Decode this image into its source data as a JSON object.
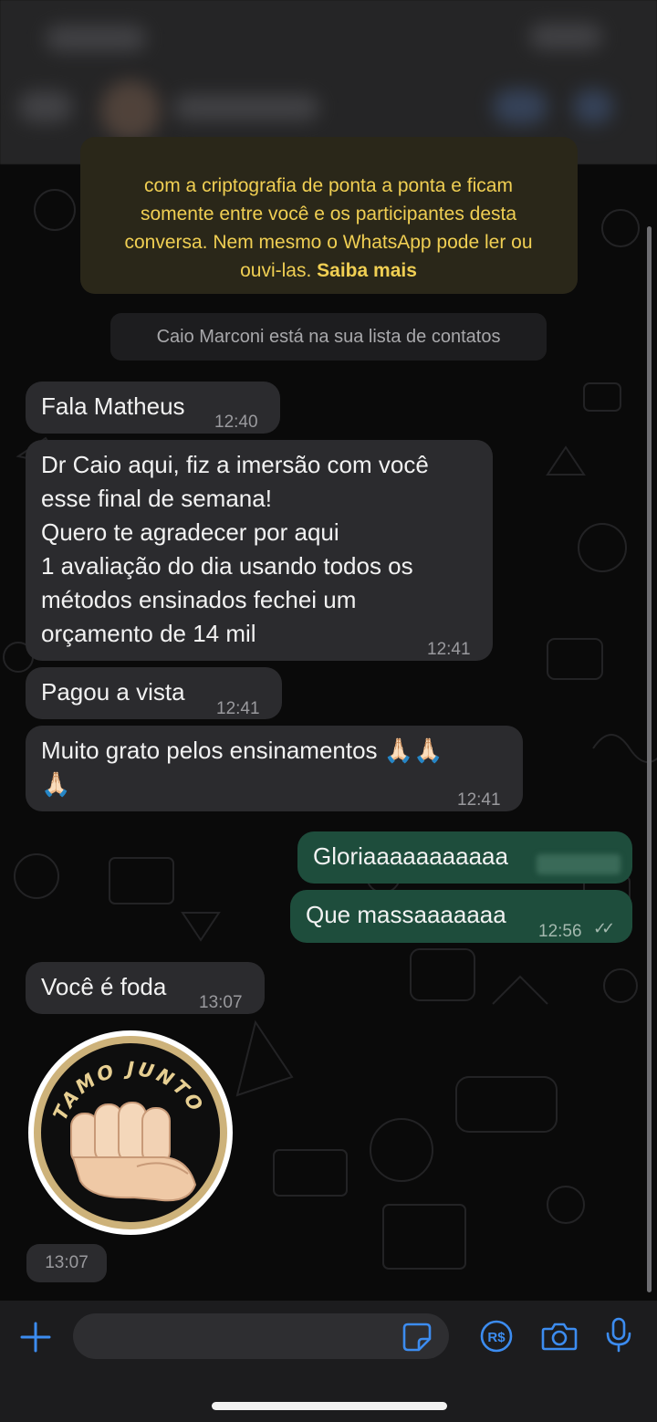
{
  "notice": {
    "line1": "com a criptografia de ponta a ponta e ficam",
    "line2": "somente entre você e os participantes desta",
    "line3": "conversa. Nem mesmo o WhatsApp pode ler ou",
    "line4_prefix": "ouvi-las.",
    "link": "Saiba mais"
  },
  "contact_notice": "Caio Marconi está na sua lista de contatos",
  "messages": [
    {
      "text": "Fala Matheus",
      "time": "12:40"
    },
    {
      "text": "Dr Caio aqui, fiz a imersão com você\nesse final de semana!\nQuero te agradecer por aqui\n1 avaliação do dia usando todos os\nmétodos ensinados fechei um\norçamento de 14 mil",
      "time": "12:41"
    },
    {
      "text": "Pagou a vista",
      "time": "12:41"
    },
    {
      "text": "Muito grato pelos ensinamentos 🙏🏻🙏🏻\n🙏🏻",
      "time": "12:41"
    },
    {
      "text": "Gloriaaaaaaaaaaa",
      "time": ""
    },
    {
      "text": "Que massaaaaaaa",
      "time": "12:56"
    },
    {
      "text": "Você é foda",
      "time": "13:07"
    }
  ],
  "sticker": {
    "text": "TAMO JUNTO",
    "time": "13:07"
  },
  "input": {
    "placeholder": ""
  },
  "icons": {
    "add": "plus-icon",
    "sticker": "sticker-icon",
    "payment": "payment-icon",
    "camera": "camera-icon",
    "mic": "microphone-icon"
  },
  "colors": {
    "incoming_bubble": "#2b2b2e",
    "outgoing_bubble": "#1e4d3c",
    "notice_text": "#f0cf53",
    "accent": "#3c8cf0"
  }
}
